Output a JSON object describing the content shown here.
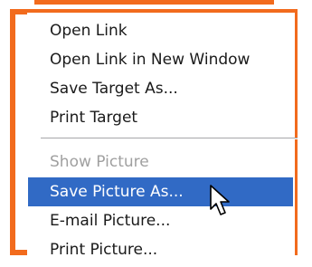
{
  "context_menu": {
    "items": [
      {
        "label": "Open Link",
        "state": "normal"
      },
      {
        "label": "Open Link in New Window",
        "state": "normal"
      },
      {
        "label": "Save Target As...",
        "state": "normal"
      },
      {
        "label": "Print Target",
        "state": "normal"
      },
      {
        "label": "Show Picture",
        "state": "disabled"
      },
      {
        "label": "Save Picture As...",
        "state": "highlighted"
      },
      {
        "label": "E-mail Picture...",
        "state": "normal"
      },
      {
        "label": "Print Picture...",
        "state": "normal"
      }
    ]
  },
  "colors": {
    "frame": "#f26b1d",
    "highlight": "#316ac5",
    "text": "#1a1a1a",
    "disabled_text": "#a0a0a0"
  },
  "icons": {
    "cursor": "arrow-pointer-icon"
  }
}
